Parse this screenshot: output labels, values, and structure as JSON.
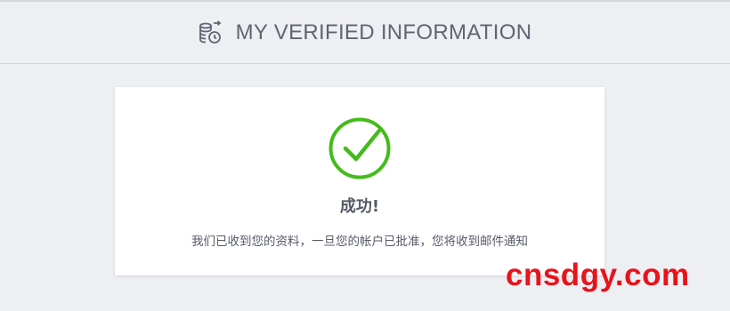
{
  "header": {
    "title": "MY VERIFIED INFORMATION",
    "icon": "verified-coins-icon"
  },
  "card": {
    "status_icon": "check-circle-icon",
    "title": "成功!",
    "message": "我们已收到您的资料，一旦您的帐户已批准，您将收到邮件通知"
  },
  "watermark": {
    "text": "cnsdgy.com"
  },
  "colors": {
    "page_background": "#eeeff3",
    "success_green": "#44bb1b",
    "text_gray": "#555b66",
    "watermark_red": "#e8131b"
  }
}
